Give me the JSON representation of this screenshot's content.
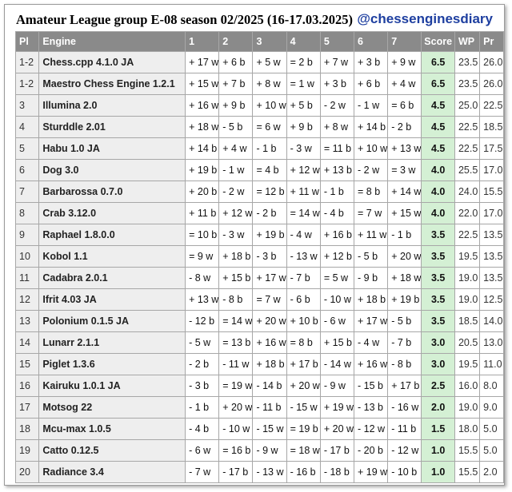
{
  "header": {
    "title": "Amateur League group E-08 season 02/2025 (16-17.03.2025)",
    "handle": "@chessenginesdiary"
  },
  "columns": [
    "Pl",
    "Engine",
    "1",
    "2",
    "3",
    "4",
    "5",
    "6",
    "7",
    "Score",
    "WP",
    "Pr"
  ],
  "rows": [
    {
      "pl": "1-2",
      "engine": "Chess.cpp 4.1.0 JA",
      "r": [
        "+ 17 w",
        "+ 6 b",
        "+ 5 w",
        "= 2 b",
        "+ 7 w",
        "+ 3 b",
        "+ 9 w"
      ],
      "score": "6.5",
      "wp": "23.5",
      "pr": "26.0"
    },
    {
      "pl": "1-2",
      "engine": "Maestro Chess Engine 1.2.1",
      "r": [
        "+ 15 w",
        "+ 7 b",
        "+ 8 w",
        "= 1 w",
        "+ 3 b",
        "+ 6 b",
        "+ 4 w"
      ],
      "score": "6.5",
      "wp": "23.5",
      "pr": "26.0"
    },
    {
      "pl": "3",
      "engine": "Illumina 2.0",
      "r": [
        "+ 16 w",
        "+ 9 b",
        "+ 10 w",
        "+ 5 b",
        "- 2 w",
        "- 1 w",
        "= 6 b"
      ],
      "score": "4.5",
      "wp": "25.0",
      "pr": "22.5"
    },
    {
      "pl": "4",
      "engine": "Sturddle 2.01",
      "r": [
        "+ 18 w",
        "- 5 b",
        "= 6 w",
        "+ 9 b",
        "+ 8 w",
        "+ 14 b",
        "- 2 b"
      ],
      "score": "4.5",
      "wp": "22.5",
      "pr": "18.5"
    },
    {
      "pl": "5",
      "engine": "Habu 1.0 JA",
      "r": [
        "+ 14 b",
        "+ 4 w",
        "- 1 b",
        "- 3 w",
        "= 11 b",
        "+ 10 w",
        "+ 13 w"
      ],
      "score": "4.5",
      "wp": "22.5",
      "pr": "17.5"
    },
    {
      "pl": "6",
      "engine": "Dog 3.0",
      "r": [
        "+ 19 b",
        "- 1 w",
        "= 4 b",
        "+ 12 w",
        "+ 13 b",
        "- 2 w",
        "= 3 w"
      ],
      "score": "4.0",
      "wp": "25.5",
      "pr": "17.0"
    },
    {
      "pl": "7",
      "engine": "Barbarossa 0.7.0",
      "r": [
        "+ 20 b",
        "- 2 w",
        "= 12 b",
        "+ 11 w",
        "- 1 b",
        "= 8 b",
        "+ 14 w"
      ],
      "score": "4.0",
      "wp": "24.0",
      "pr": "15.5"
    },
    {
      "pl": "8",
      "engine": "Crab 3.12.0",
      "r": [
        "+ 11 b",
        "+ 12 w",
        "- 2 b",
        "= 14 w",
        "- 4 b",
        "= 7 w",
        "+ 15 w"
      ],
      "score": "4.0",
      "wp": "22.0",
      "pr": "17.0"
    },
    {
      "pl": "9",
      "engine": "Raphael 1.8.0.0",
      "r": [
        "= 10 b",
        "- 3 w",
        "+ 19 b",
        "- 4 w",
        "+ 16 b",
        "+ 11 w",
        "- 1 b"
      ],
      "score": "3.5",
      "wp": "22.5",
      "pr": "13.5"
    },
    {
      "pl": "10",
      "engine": "Kobol 1.1",
      "r": [
        "= 9 w",
        "+ 18 b",
        "- 3 b",
        "- 13 w",
        "+ 12 b",
        "- 5 b",
        "+ 20 w"
      ],
      "score": "3.5",
      "wp": "19.5",
      "pr": "13.5"
    },
    {
      "pl": "11",
      "engine": "Cadabra 2.0.1",
      "r": [
        "- 8 w",
        "+ 15 b",
        "+ 17 w",
        "- 7 b",
        "= 5 w",
        "- 9 b",
        "+ 18 w"
      ],
      "score": "3.5",
      "wp": "19.0",
      "pr": "13.5"
    },
    {
      "pl": "12",
      "engine": "Ifrit 4.03 JA",
      "r": [
        "+ 13 w",
        "- 8 b",
        "= 7 w",
        "- 6 b",
        "- 10 w",
        "+ 18 b",
        "+ 19 b"
      ],
      "score": "3.5",
      "wp": "19.0",
      "pr": "12.5"
    },
    {
      "pl": "13",
      "engine": "Polonium 0.1.5 JA",
      "r": [
        "- 12 b",
        "= 14 w",
        "+ 20 w",
        "+ 10 b",
        "- 6 w",
        "+ 17 w",
        "- 5 b"
      ],
      "score": "3.5",
      "wp": "18.5",
      "pr": "14.0"
    },
    {
      "pl": "14",
      "engine": "Lunarr 2.1.1",
      "r": [
        "- 5 w",
        "= 13 b",
        "+ 16 w",
        "= 8 b",
        "+ 15 b",
        "- 4 w",
        "- 7 b"
      ],
      "score": "3.0",
      "wp": "20.5",
      "pr": "13.0"
    },
    {
      "pl": "15",
      "engine": "Piglet 1.3.6",
      "r": [
        "- 2 b",
        "- 11 w",
        "+ 18 b",
        "+ 17 b",
        "- 14 w",
        "+ 16 w",
        "- 8 b"
      ],
      "score": "3.0",
      "wp": "19.5",
      "pr": "11.0"
    },
    {
      "pl": "16",
      "engine": "Kairuku 1.0.1 JA",
      "r": [
        "- 3 b",
        "= 19 w",
        "- 14 b",
        "+ 20 w",
        "- 9 w",
        "- 15 b",
        "+ 17 b"
      ],
      "score": "2.5",
      "wp": "16.0",
      "pr": "8.0"
    },
    {
      "pl": "17",
      "engine": "Motsog 22",
      "r": [
        "- 1 b",
        "+ 20 w",
        "- 11 b",
        "- 15 w",
        "+ 19 w",
        "- 13 b",
        "- 16 w"
      ],
      "score": "2.0",
      "wp": "19.0",
      "pr": "9.0"
    },
    {
      "pl": "18",
      "engine": "Mcu-max 1.0.5",
      "r": [
        "- 4 b",
        "- 10 w",
        "- 15 w",
        "= 19 b",
        "+ 20 w",
        "- 12 w",
        "- 11 b"
      ],
      "score": "1.5",
      "wp": "18.0",
      "pr": "5.0"
    },
    {
      "pl": "19",
      "engine": "Catto 0.12.5",
      "r": [
        "- 6 w",
        "= 16 b",
        "- 9 w",
        "= 18 w",
        "- 17 b",
        "- 20 b",
        "- 12 w"
      ],
      "score": "1.0",
      "wp": "15.5",
      "pr": "5.0"
    },
    {
      "pl": "20",
      "engine": "Radiance 3.4",
      "r": [
        "- 7 w",
        "- 17 b",
        "- 13 w",
        "- 16 b",
        "- 18 b",
        "+ 19 w",
        "- 10 b"
      ],
      "score": "1.0",
      "wp": "15.5",
      "pr": "2.0"
    }
  ]
}
